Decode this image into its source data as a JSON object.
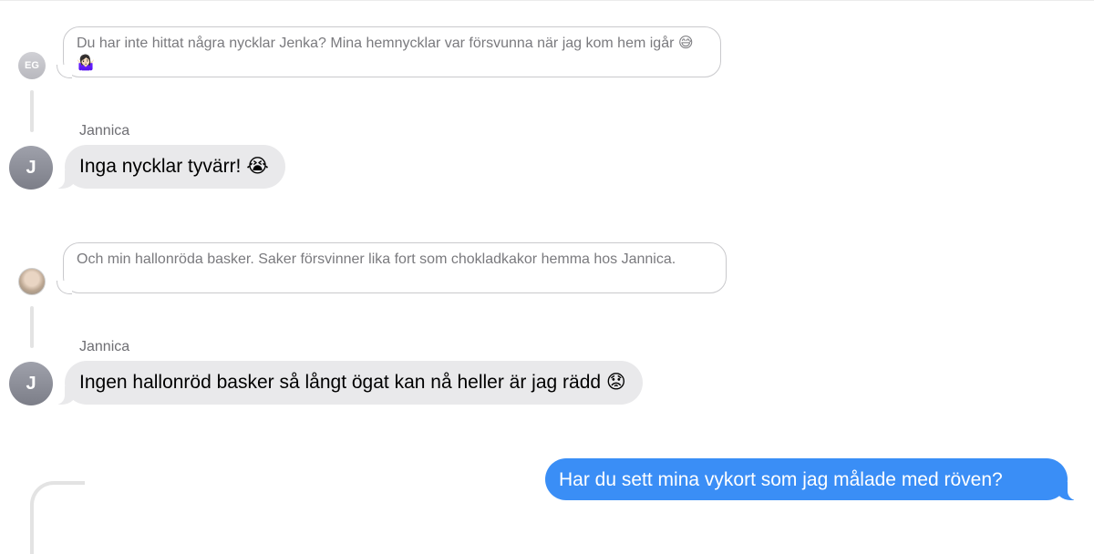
{
  "messages": [
    {
      "type": "reply_quote",
      "avatar": "EG",
      "text": "Du har inte hittat några nycklar Jenka? Mina hemnycklar var försvunna när jag kom hem igår 😅🤷🏻‍♀️"
    },
    {
      "type": "incoming",
      "sender": "Jannica",
      "avatar": "J",
      "text": "Inga nycklar tyvärr! 😭"
    },
    {
      "type": "reply_quote",
      "avatar": "photo",
      "text": "Och min hallonröda basker. Saker försvinner lika fort som chokladkakor hemma hos Jannica."
    },
    {
      "type": "incoming",
      "sender": "Jannica",
      "avatar": "J",
      "text": "Ingen hallonröd basker så långt ögat kan nå heller är jag rädd 😟"
    },
    {
      "type": "outgoing",
      "text": "Har du sett mina vykort som jag målade med röven?"
    }
  ],
  "colors": {
    "outgoing_bubble": "#3a8ef6",
    "incoming_bubble": "#e9e9eb",
    "quote_border": "#c9c9cc",
    "thread_line": "#e3e3e3"
  }
}
